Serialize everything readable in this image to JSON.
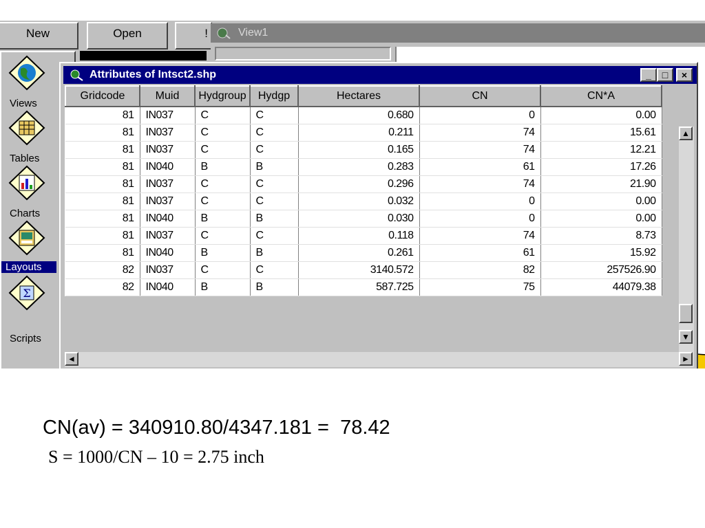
{
  "toolbar": {
    "new_label": "New",
    "open_label": "Open",
    "print_label": "!"
  },
  "view_window": {
    "title": "View1"
  },
  "project_panel": {
    "items": [
      {
        "label": "Views",
        "icon": "views-globe-icon"
      },
      {
        "label": "Tables",
        "icon": "tables-grid-icon"
      },
      {
        "label": "Charts",
        "icon": "charts-bar-icon"
      },
      {
        "label": "Layouts",
        "icon": "layouts-icon",
        "selected": true
      },
      {
        "label": "Scripts",
        "icon": "scripts-sigma-icon"
      }
    ]
  },
  "attributes_window": {
    "title": "Attributes of Intsct2.shp",
    "columns": [
      "Gridcode",
      "Muid",
      "Hydgroup",
      "Hydgp",
      "Hectares",
      "CN",
      "CN*A"
    ],
    "rows": [
      [
        "81",
        "IN037",
        "C",
        "C",
        "0.680",
        "0",
        "0.00"
      ],
      [
        "81",
        "IN037",
        "C",
        "C",
        "0.211",
        "74",
        "15.61"
      ],
      [
        "81",
        "IN037",
        "C",
        "C",
        "0.165",
        "74",
        "12.21"
      ],
      [
        "81",
        "IN040",
        "B",
        "B",
        "0.283",
        "61",
        "17.26"
      ],
      [
        "81",
        "IN037",
        "C",
        "C",
        "0.296",
        "74",
        "21.90"
      ],
      [
        "81",
        "IN037",
        "C",
        "C",
        "0.032",
        "0",
        "0.00"
      ],
      [
        "81",
        "IN040",
        "B",
        "B",
        "0.030",
        "0",
        "0.00"
      ],
      [
        "81",
        "IN037",
        "C",
        "C",
        "0.118",
        "74",
        "8.73"
      ],
      [
        "81",
        "IN040",
        "B",
        "B",
        "0.261",
        "61",
        "15.92"
      ],
      [
        "82",
        "IN037",
        "C",
        "C",
        "3140.572",
        "82",
        "257526.90"
      ],
      [
        "82",
        "IN040",
        "B",
        "B",
        "587.725",
        "75",
        "44079.38"
      ]
    ]
  },
  "formulas": {
    "line1": "CN(av) = 340910.80/4347.181 =  78.42",
    "line2": "S = 1000/CN – 10 = 2.75 inch"
  },
  "colors": {
    "title_bar": "#000080",
    "window_bg": "#c0c0c0",
    "inactive_title": "#808080",
    "accent_yellow": "#f5c800"
  }
}
